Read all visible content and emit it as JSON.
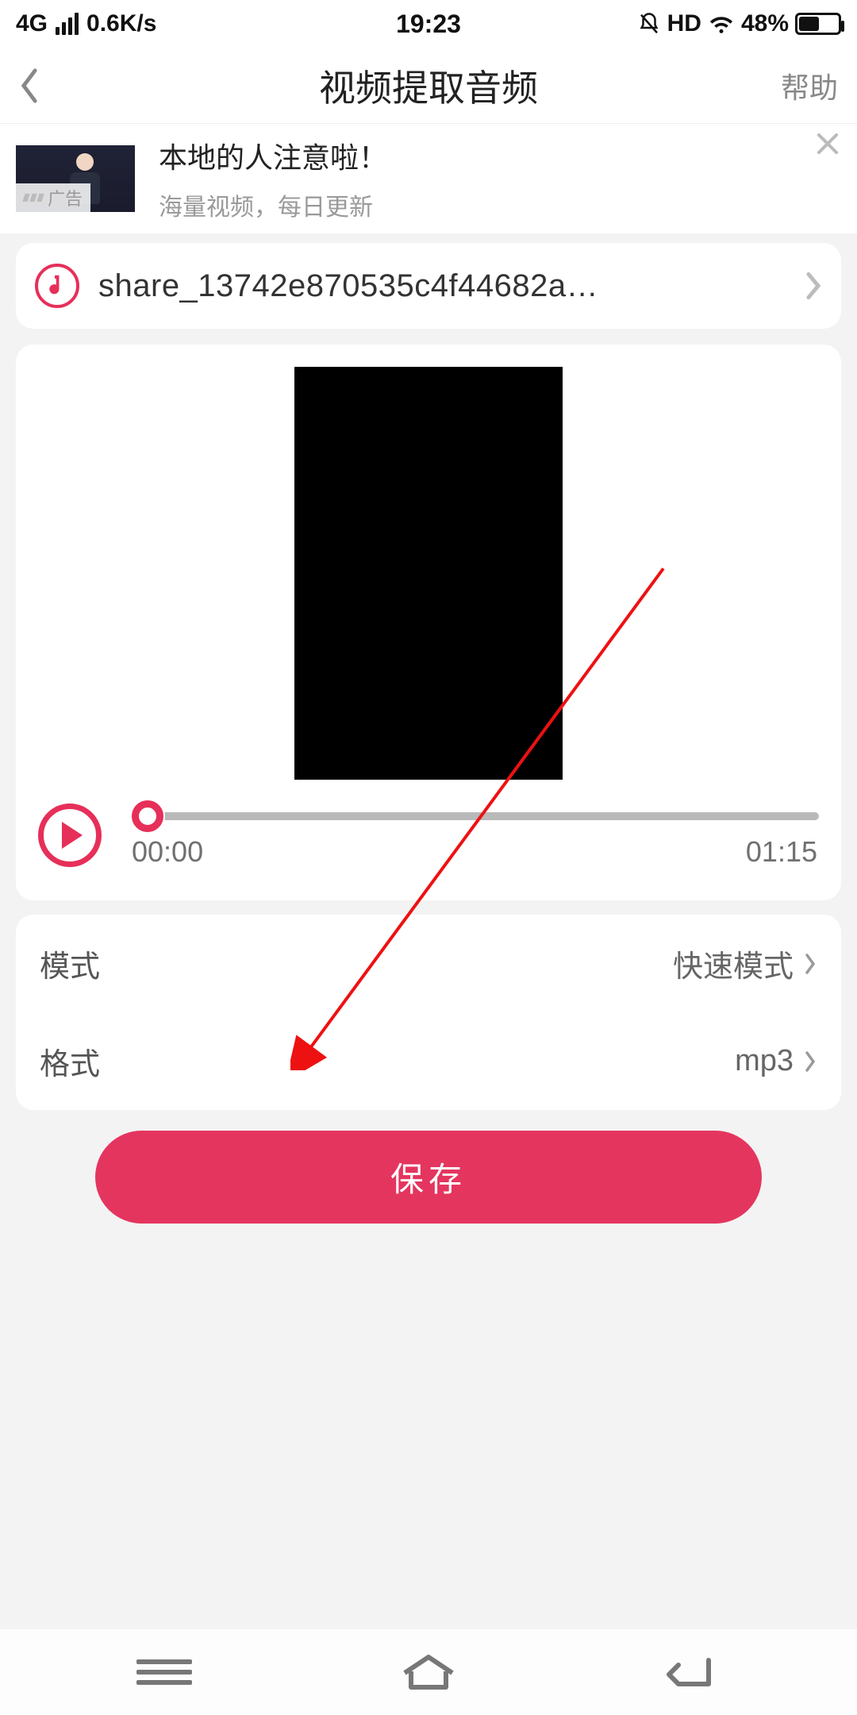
{
  "status_bar": {
    "net": "4G",
    "speed": "0.6K/s",
    "time": "19:23",
    "hd": "HD",
    "battery_pct": "48%"
  },
  "header": {
    "title": "视频提取音频",
    "help": "帮助"
  },
  "ad": {
    "badge": "广告",
    "title": "本地的人注意啦！",
    "subtitle": "海量视频，每日更新"
  },
  "file": {
    "name": "share_13742e870535c4f44682a…"
  },
  "player": {
    "current": "00:00",
    "total": "01:15"
  },
  "settings": {
    "mode_label": "模式",
    "mode_value": "快速模式",
    "format_label": "格式",
    "format_value": "mp3"
  },
  "save_label": "保存",
  "colors": {
    "accent": "#e62f59"
  }
}
